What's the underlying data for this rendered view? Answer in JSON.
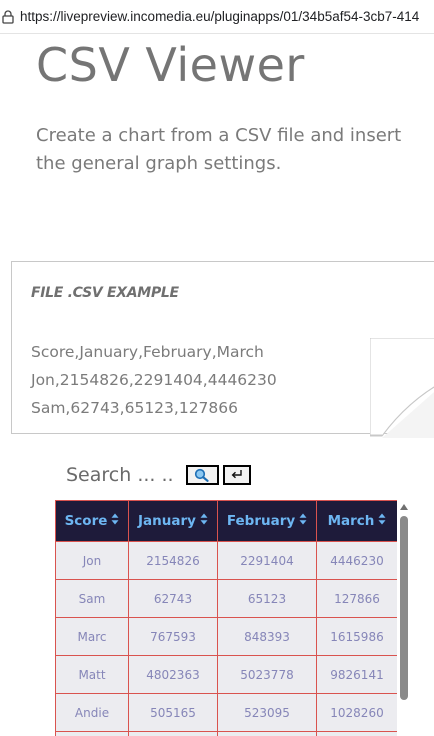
{
  "browser": {
    "url": "https://livepreview.incomedia.eu/pluginapps/01/34b5af54-3cb7-414"
  },
  "page": {
    "title": "CSV Viewer",
    "subtitle": "Create a chart from a CSV file and insert the general graph settings."
  },
  "example": {
    "heading": "FILE .CSV EXAMPLE",
    "lines": [
      "Score,January,February,March",
      "Jon,2154826,2291404,4446230",
      "Sam,62743,65123,127866"
    ]
  },
  "search": {
    "label": "Search ... .."
  },
  "table": {
    "headers": [
      "Score",
      "January",
      "February",
      "March"
    ],
    "rows": [
      [
        "Jon",
        "2154826",
        "2291404",
        "4446230"
      ],
      [
        "Sam",
        "62743",
        "65123",
        "127866"
      ],
      [
        "Marc",
        "767593",
        "848393",
        "1615986"
      ],
      [
        "Matt",
        "4802363",
        "5023778",
        "9826141"
      ],
      [
        "Andie",
        "505165",
        "523095",
        "1028260"
      ],
      [
        "",
        "",
        "",
        ""
      ]
    ]
  },
  "colors": {
    "header_bg": "#1e1b3a",
    "header_text": "#6db6f2",
    "cell_border": "#d9534f",
    "cell_text": "#8686b8"
  },
  "icons": {
    "lock": "site-info-icon",
    "search": "magnifier-icon",
    "reset": "return-arrow-icon",
    "sort": "sort-arrows-icon"
  }
}
